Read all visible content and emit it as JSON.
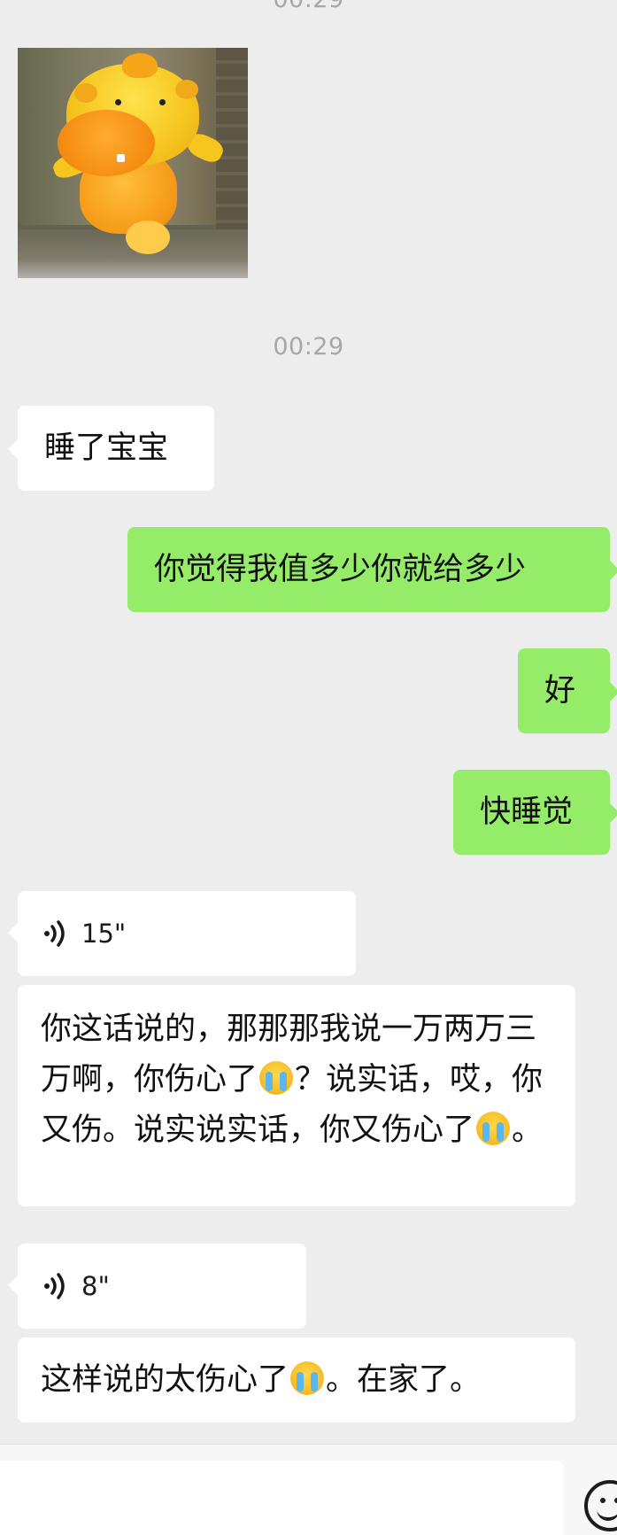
{
  "timestamps": {
    "top": "00:29",
    "second": "00:29"
  },
  "messages": {
    "left_1": "睡了宝宝",
    "right_1": "你觉得我值多少你就给多少",
    "right_2": "好",
    "right_3": "快睡觉",
    "voice_1": {
      "duration": "15\"",
      "transcript_parts": [
        "你这话说的，那那那我说一万两万三万啊，你伤心了",
        "？说实话，哎，你又伤。说实说实话，你又伤心了",
        "。"
      ]
    },
    "voice_2": {
      "duration": "8\"",
      "transcript_parts": [
        "这样说的太伤心了",
        "。在家了。"
      ]
    }
  },
  "icons": {
    "voice": "voice-wave-icon",
    "emoji": "crying-emoji-icon",
    "input_emoji": "emoji-button-icon"
  },
  "colors": {
    "background": "#ededed",
    "left_bubble": "#ffffff",
    "right_bubble": "#95ec69",
    "timestamp": "#a7a7a7"
  }
}
